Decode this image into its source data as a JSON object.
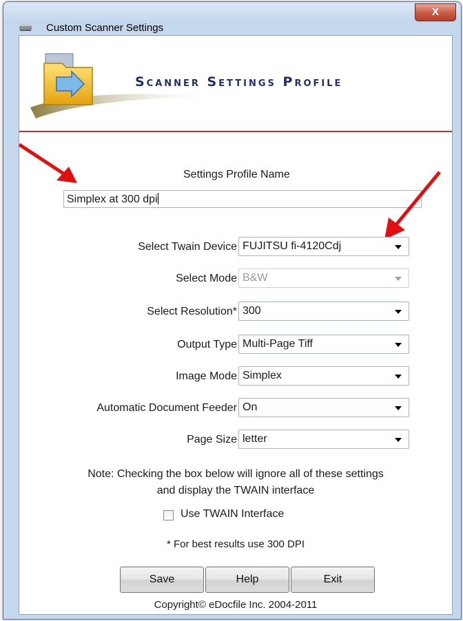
{
  "window": {
    "title": "Custom Scanner Settings",
    "close_glyph": "X"
  },
  "header": {
    "title": "Scanner Settings Profile"
  },
  "profile": {
    "label": "Settings Profile Name",
    "value": "Simplex at 300 dpi"
  },
  "fields": [
    {
      "label": "Select Twain Device",
      "value": "FUJITSU fi-4120Cdj",
      "enabled": true
    },
    {
      "label": "Select Mode",
      "value": "B&W",
      "enabled": false
    },
    {
      "label": "Select Resolution*",
      "value": "300",
      "enabled": true
    },
    {
      "label": "Output Type",
      "value": "Multi-Page Tiff",
      "enabled": true
    },
    {
      "label": "Image Mode",
      "value": "Simplex",
      "enabled": true
    },
    {
      "label": "Automatic Document Feeder",
      "value": "On",
      "enabled": true
    },
    {
      "label": "Page Size",
      "value": "letter",
      "enabled": true
    }
  ],
  "note": {
    "line1": "Note: Checking the box below will ignore all of these settings",
    "line2": "and display the TWAIN interface"
  },
  "twain_checkbox": {
    "label": "Use TWAIN Interface",
    "checked": false
  },
  "tip": "* For best results use 300 DPI",
  "buttons": {
    "save": "Save",
    "help": "Help",
    "exit": "Exit"
  },
  "copyright": "Copyright© eDocfile Inc. 2004-2011",
  "colors": {
    "accent_red": "#c8242a",
    "title_blue": "#1e2f6b",
    "arrow_red": "#e01010"
  },
  "icons": [
    "scanner-app-icon",
    "close-icon",
    "folder-logo-icon",
    "annotation-arrow",
    "dropdown-arrow-icon"
  ]
}
